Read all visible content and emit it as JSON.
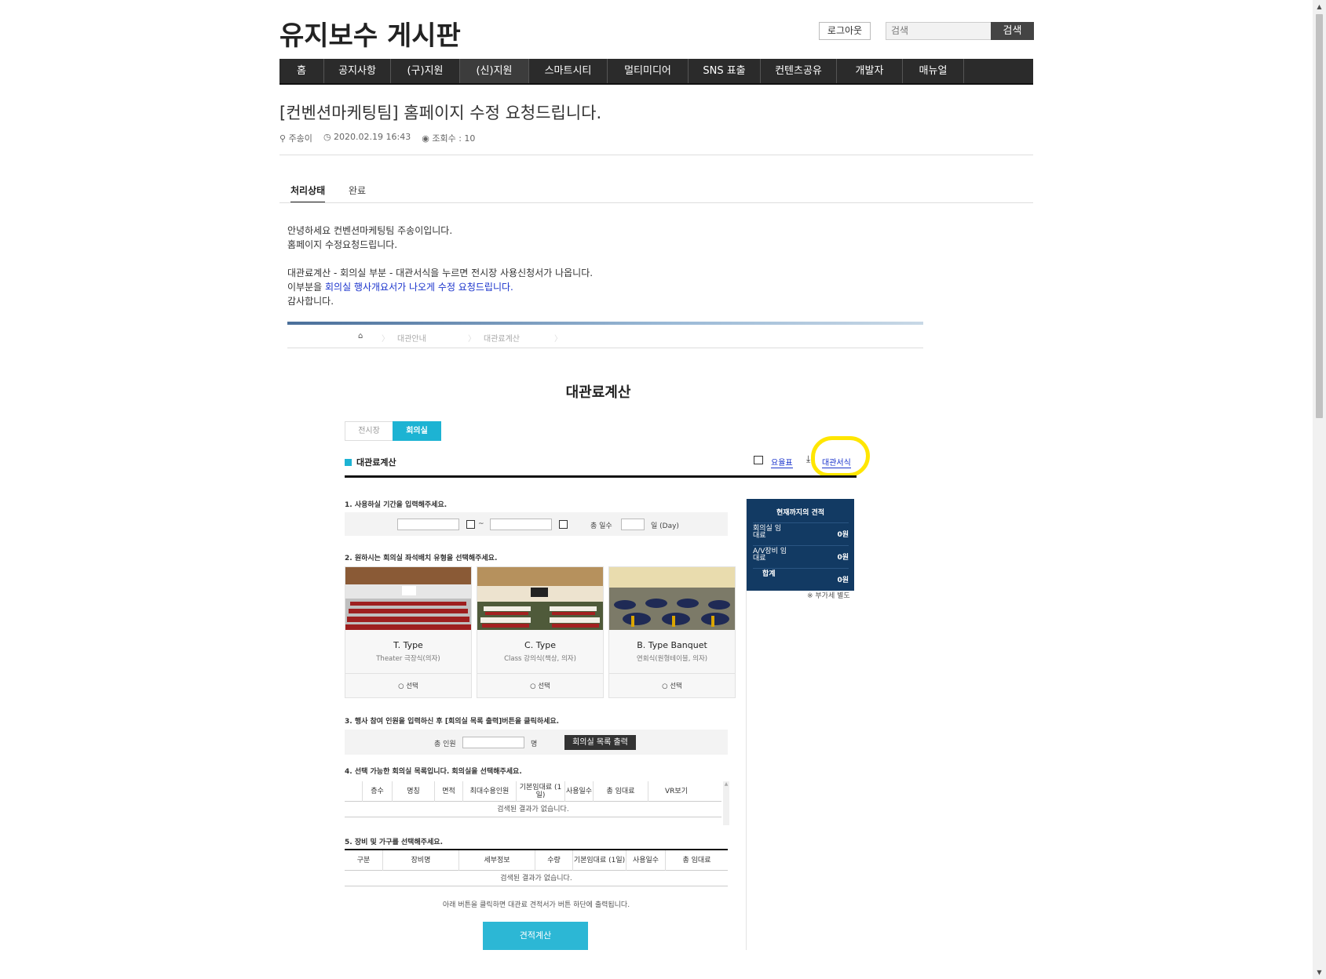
{
  "header": {
    "site_title": "유지보수 게시판",
    "logout_label": "로그아웃",
    "search_placeholder": "검색",
    "search_button": "검색"
  },
  "nav": [
    "홈",
    "공지사항",
    "(구)지원",
    "(신)지원",
    "스마트시티",
    "멀티미디어",
    "SNS 표출",
    "컨텐츠공유",
    "개발자",
    "매뉴얼"
  ],
  "post": {
    "title": "[컨벤션마케팅팀] 홈페이지 수정 요청드립니다.",
    "author": "주송이",
    "datetime": "2020.02.19 16:43",
    "views": "조회수 : 10",
    "status_label": "처리상태",
    "status_value": "완료",
    "body": {
      "line1": "안녕하세요 컨벤션마케팅팀 주송이입니다.",
      "line2": "홈페이지 수정요청드립니다.",
      "line3": "대관료계산 - 회의실 부분 - 대관서식을 누르면 전시장 사용신청서가 나옵니다.",
      "line4_prefix": "이부분을 ",
      "line4_blue": "회의실 행사개요서가 나오게 수정 요청드립니다.",
      "line5": "감사합니다."
    }
  },
  "screenshot": {
    "breadcrumb": [
      "대관안내",
      "대관료계산"
    ],
    "title": "대관료계산",
    "tabs": [
      "전시장",
      "회의실"
    ],
    "section_title": "대관료계산",
    "link_rates": "요율표",
    "link_form": "대관서식",
    "step1": "1. 사용하실 기간을 입력해주세요.",
    "total_days_label": "총 일수",
    "day_unit": "일 (Day)",
    "tilde": "~",
    "step2": "2. 원하시는 회의실 좌석배치 유형을 선택해주세요.",
    "types": [
      {
        "title": "T. Type",
        "sub": "Theater 극장식(의자)",
        "select": "○ 선택"
      },
      {
        "title": "C. Type",
        "sub": "Class 강의식(책상, 의자)",
        "select": "○ 선택"
      },
      {
        "title": "B. Type Banquet",
        "sub": "연회식(원형테이블, 의자)",
        "select": "○ 선택"
      }
    ],
    "step3": "3. 행사 참여 인원을 입력하신 후 [회의실 목록 출력]버튼을 클릭하세요.",
    "total_people_label": "총 인원",
    "people_unit": "명",
    "list_button": "회의실 목록 출력",
    "step4": "4. 선택 가능한 회의실 목록입니다. 회의실을 선택해주세요.",
    "table4_headers": [
      "층수",
      "명칭",
      "면적",
      "최대수용인원",
      "기본임대료 (1일)",
      "사용일수",
      "총 임대료",
      "VR보기"
    ],
    "table4_empty": "검색된 결과가 없습니다.",
    "step5": "5. 장비 및 가구를 선택해주세요.",
    "table5_headers": [
      "구분",
      "장비명",
      "세부정보",
      "수량",
      "기본임대료 (1일)",
      "사용일수",
      "총 임대료"
    ],
    "table5_empty": "검색된 결과가 없습니다.",
    "note": "아래 버튼을 클릭하면 대관료 견적서가 버튼 하단에 출력됩니다.",
    "calc_button": "견적계산",
    "estimate": {
      "title": "현재까지의 견적",
      "rows": [
        {
          "label": "회의실 임대료",
          "value": "0원"
        },
        {
          "label": "A/V장비 임대료",
          "value": "0원"
        },
        {
          "label": "합계",
          "value": "0원"
        }
      ],
      "vat_note": "※ 부가세 별도"
    }
  },
  "colors": {
    "nav_bg": "#2b2b2b",
    "accent": "#1db3d3",
    "estimate_bg": "#123a63",
    "highlight": "#ffe600",
    "link": "#1a33cc"
  }
}
